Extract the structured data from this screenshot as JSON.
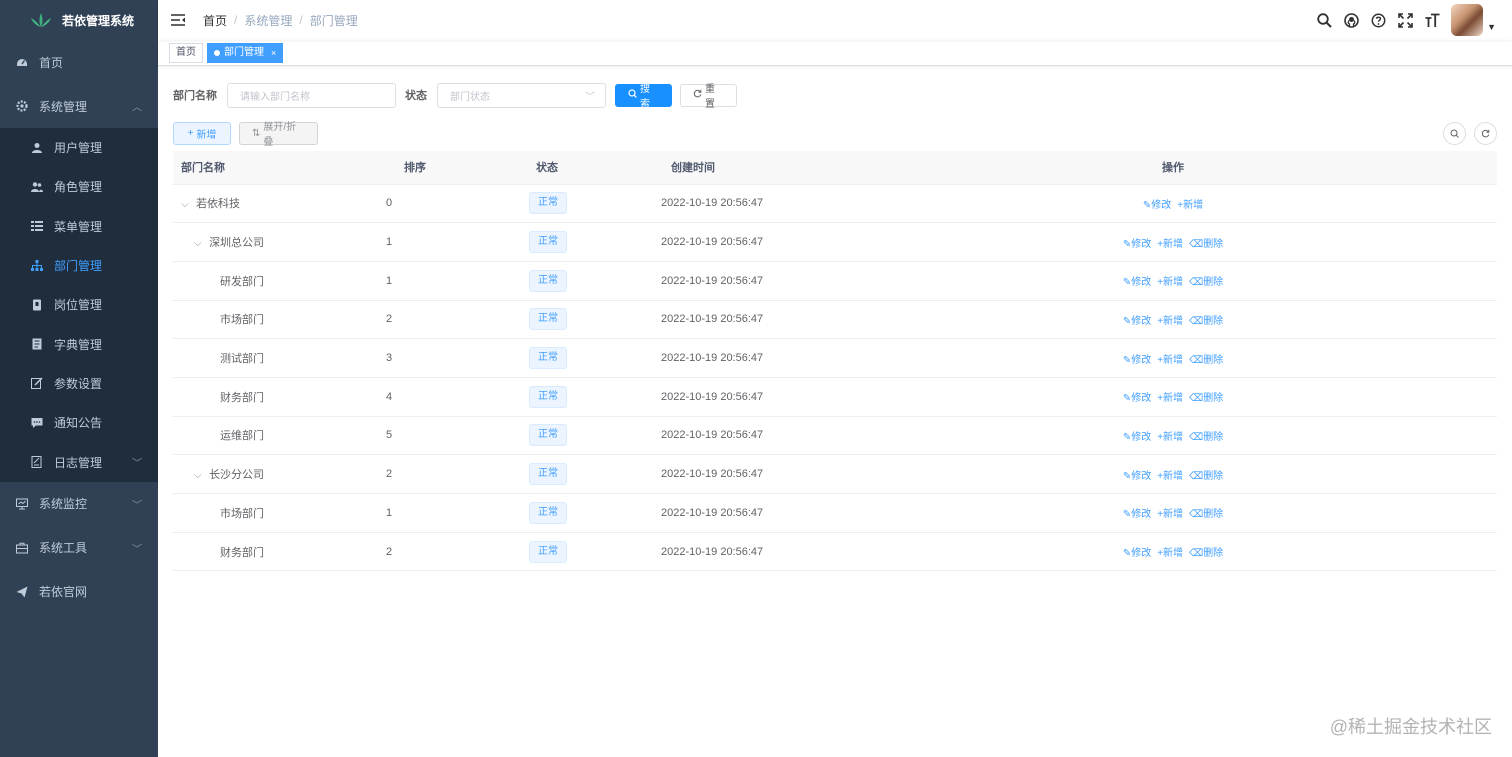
{
  "app": {
    "title": "若依管理系统"
  },
  "sidebar": {
    "items": [
      {
        "label": "首页",
        "icon": "dashboard-icon"
      },
      {
        "label": "系统管理",
        "icon": "gear-icon",
        "expanded": true
      },
      {
        "label": "系统监控",
        "icon": "monitor-icon"
      },
      {
        "label": "系统工具",
        "icon": "toolbox-icon"
      },
      {
        "label": "若依官网",
        "icon": "send-icon"
      }
    ],
    "sub_items": [
      {
        "label": "用户管理",
        "icon": "user-icon"
      },
      {
        "label": "角色管理",
        "icon": "peoples-icon"
      },
      {
        "label": "菜单管理",
        "icon": "tree-table-icon"
      },
      {
        "label": "部门管理",
        "icon": "tree-icon",
        "active": true
      },
      {
        "label": "岗位管理",
        "icon": "post-icon"
      },
      {
        "label": "字典管理",
        "icon": "dict-icon"
      },
      {
        "label": "参数设置",
        "icon": "edit-icon"
      },
      {
        "label": "通知公告",
        "icon": "message-icon"
      },
      {
        "label": "日志管理",
        "icon": "log-icon"
      }
    ]
  },
  "header": {
    "breadcrumb": [
      "首页",
      "系统管理",
      "部门管理"
    ],
    "separator": "/"
  },
  "tags": [
    {
      "label": "首页"
    },
    {
      "label": "部门管理",
      "active": true,
      "close": "×"
    }
  ],
  "search": {
    "name_label": "部门名称",
    "name_placeholder": "请输入部门名称",
    "status_label": "状态",
    "status_placeholder": "部门状态",
    "search_button": "搜索",
    "reset_button": "重置"
  },
  "toolbar": {
    "add_button": "新增",
    "toggle_button": "展开/折叠"
  },
  "table": {
    "columns": [
      "部门名称",
      "排序",
      "状态",
      "创建时间",
      "操作"
    ],
    "rows": [
      {
        "name": "若依科技",
        "sort": "0",
        "status": "正常",
        "time": "2022-10-19 20:56:47",
        "level": 0,
        "expander": true,
        "ops": [
          "修改",
          "新增"
        ]
      },
      {
        "name": "深圳总公司",
        "sort": "1",
        "status": "正常",
        "time": "2022-10-19 20:56:47",
        "level": 1,
        "expander": true,
        "ops": [
          "修改",
          "新增",
          "删除"
        ]
      },
      {
        "name": "研发部门",
        "sort": "1",
        "status": "正常",
        "time": "2022-10-19 20:56:47",
        "level": 2,
        "expander": false,
        "ops": [
          "修改",
          "新增",
          "删除"
        ]
      },
      {
        "name": "市场部门",
        "sort": "2",
        "status": "正常",
        "time": "2022-10-19 20:56:47",
        "level": 2,
        "expander": false,
        "ops": [
          "修改",
          "新增",
          "删除"
        ]
      },
      {
        "name": "测试部门",
        "sort": "3",
        "status": "正常",
        "time": "2022-10-19 20:56:47",
        "level": 2,
        "expander": false,
        "ops": [
          "修改",
          "新增",
          "删除"
        ]
      },
      {
        "name": "财务部门",
        "sort": "4",
        "status": "正常",
        "time": "2022-10-19 20:56:47",
        "level": 2,
        "expander": false,
        "ops": [
          "修改",
          "新增",
          "删除"
        ]
      },
      {
        "name": "运维部门",
        "sort": "5",
        "status": "正常",
        "time": "2022-10-19 20:56:47",
        "level": 2,
        "expander": false,
        "ops": [
          "修改",
          "新增",
          "删除"
        ]
      },
      {
        "name": "长沙分公司",
        "sort": "2",
        "status": "正常",
        "time": "2022-10-19 20:56:47",
        "level": 1,
        "expander": true,
        "ops": [
          "修改",
          "新增",
          "删除"
        ]
      },
      {
        "name": "市场部门",
        "sort": "1",
        "status": "正常",
        "time": "2022-10-19 20:56:47",
        "level": 2,
        "expander": false,
        "ops": [
          "修改",
          "新增",
          "删除"
        ]
      },
      {
        "name": "财务部门",
        "sort": "2",
        "status": "正常",
        "time": "2022-10-19 20:56:47",
        "level": 2,
        "expander": false,
        "ops": [
          "修改",
          "新增",
          "删除"
        ]
      }
    ]
  },
  "watermark": "@稀土掘金技术社区",
  "colors": {
    "sidebar_bg": "#304156",
    "submenu_bg": "#1f2d3d",
    "primary": "#1890ff",
    "link": "#409eff"
  }
}
